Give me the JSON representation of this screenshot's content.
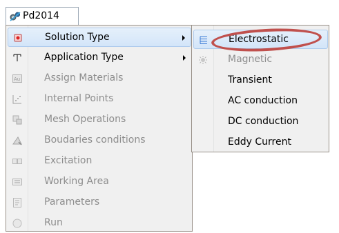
{
  "menubar": {
    "tab_label": "Pd2014",
    "tab_icon": "app-gears-icon"
  },
  "dropdown": {
    "items": [
      {
        "label": "Solution Type",
        "icon": "solution-type-icon",
        "enabled": true,
        "has_submenu": true,
        "selected": true
      },
      {
        "label": "Application Type",
        "icon": "application-type-icon",
        "enabled": true,
        "has_submenu": true,
        "selected": false
      },
      {
        "label": "Assign Materials",
        "icon": "materials-icon",
        "enabled": false
      },
      {
        "label": "Internal Points",
        "icon": "internal-points-icon",
        "enabled": false
      },
      {
        "label": "Mesh Operations",
        "icon": "mesh-icon",
        "enabled": false
      },
      {
        "label": "Boudaries conditions",
        "icon": "boundaries-icon",
        "enabled": false
      },
      {
        "label": "Excitation",
        "icon": "excitation-icon",
        "enabled": false
      },
      {
        "label": "Working Area",
        "icon": "working-area-icon",
        "enabled": false
      },
      {
        "label": "Parameters",
        "icon": "parameters-icon",
        "enabled": false
      },
      {
        "label": "Run",
        "icon": "run-icon",
        "enabled": false
      }
    ]
  },
  "submenu": {
    "items": [
      {
        "label": "Electrostatic",
        "icon": "electrostatic-icon",
        "enabled": true,
        "selected": true,
        "circled": true
      },
      {
        "label": "Magnetic",
        "icon": "magnetic-icon",
        "enabled": false
      },
      {
        "label": "Transient",
        "enabled": true
      },
      {
        "label": "AC conduction",
        "enabled": true
      },
      {
        "label": "DC conduction",
        "enabled": true
      },
      {
        "label": "Eddy Current",
        "enabled": true
      }
    ]
  },
  "colors": {
    "highlight_ring": "#c0504d",
    "selected_bg": "#dbeaf9",
    "menu_bg": "#f0f0f0",
    "disabled_text": "#8d8d8d"
  }
}
